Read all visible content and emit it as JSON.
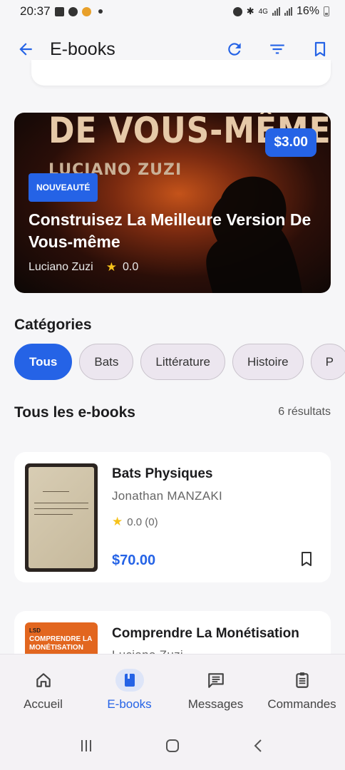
{
  "status_bar": {
    "time": "20:37",
    "battery": "16%",
    "network": "4G"
  },
  "app_bar": {
    "title": "E-books",
    "icons": [
      "back-arrow-icon",
      "refresh-icon",
      "filter-icon",
      "bookmark-icon"
    ]
  },
  "featured": {
    "cover_title": "DE VOUS-MÊME",
    "cover_author": "LUCIANO ZUZI",
    "price": "$3.00",
    "badge": "NOUVEAUTÉ",
    "title": "Construisez La Meilleure Version De Vous-même",
    "author": "Luciano Zuzi",
    "rating": "0.0"
  },
  "categories": {
    "title": "Catégories",
    "items": [
      "Tous",
      "Bats",
      "Littérature",
      "Histoire",
      "P"
    ],
    "selected": "Tous"
  },
  "list": {
    "title": "Tous les e-books",
    "count": "6 résultats",
    "items": [
      {
        "title": "Bats Physiques",
        "author": "Jonathan MANZAKI",
        "rating": "0.0 (0)",
        "price": "$70.00"
      },
      {
        "title": "Comprendre La Monétisation",
        "author": "Luciano Zuzi",
        "cover_text_1": "LSD",
        "cover_text_2": "COMPRENDRE LA MONÉTISATION"
      }
    ]
  },
  "bottom_nav": {
    "items": [
      {
        "label": "Accueil",
        "icon": "home-icon"
      },
      {
        "label": "E-books",
        "icon": "book-icon"
      },
      {
        "label": "Messages",
        "icon": "messages-icon"
      },
      {
        "label": "Commandes",
        "icon": "clipboard-icon"
      }
    ],
    "active": "E-books"
  },
  "colors": {
    "accent": "#2563e6",
    "star": "#f6c21a",
    "background": "#f6f6f8"
  }
}
